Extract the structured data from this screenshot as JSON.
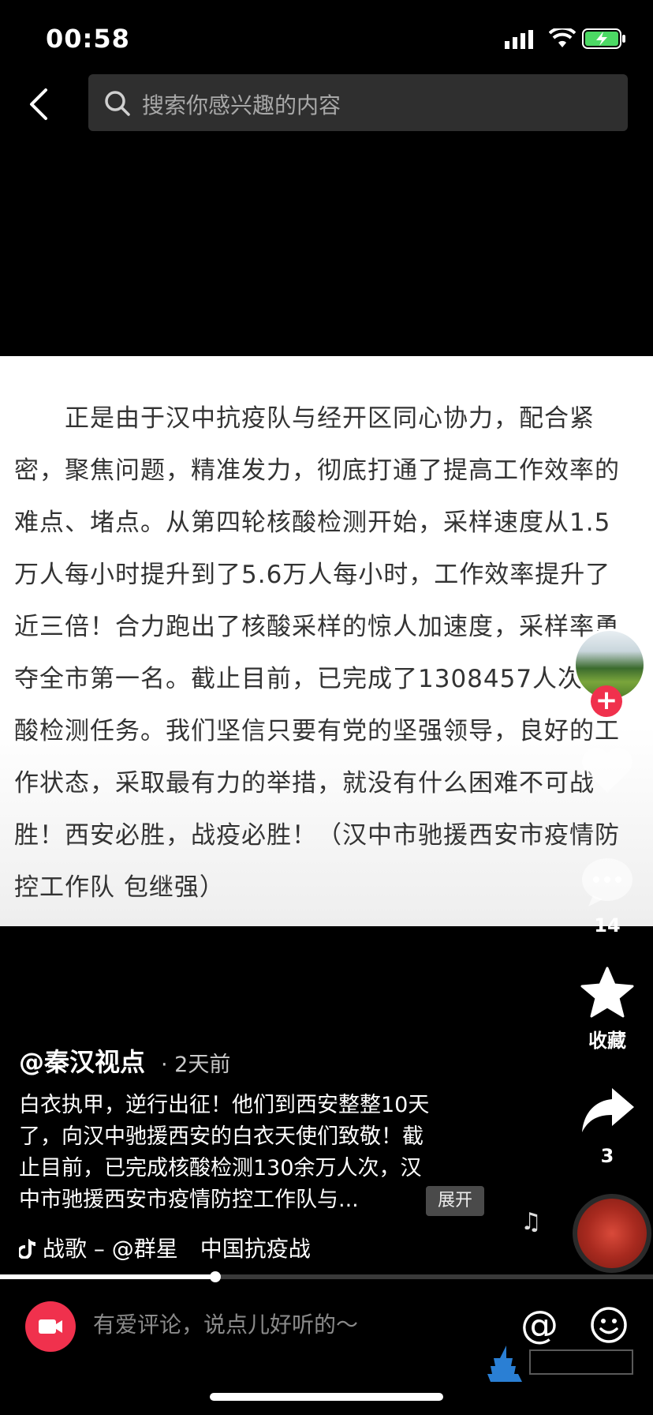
{
  "status": {
    "time": "00:58"
  },
  "search": {
    "placeholder": "搜索你感兴趣的内容"
  },
  "document_lines": [
    "　　正是由于汉中抗疫队与经开区同心协力，配合紧",
    "密，聚焦问题，精准发力，彻底打通了提高工作效率的",
    "难点、堵点。从第四轮核酸检测开始，采样速度从1.5",
    "万人每小时提升到了5.6万人每小时，工作效率提升了",
    "近三倍！合力跑出了核酸采样的惊人加速度，采样率勇",
    "夺全市第一名。截止目前，已完成了1308457人次",
    "酸检测任务。我们坚信只要有党的坚强领导，良好的工",
    "作状态，采取最有力的举措，就没有什么困难不可战",
    "胜！西安必胜，战疫必胜！（汉中市驰援西安市疫情防",
    "控工作队 包继强）"
  ],
  "actions": {
    "comment_count": "14",
    "favorite_label": "收藏",
    "share_count": "3"
  },
  "post": {
    "author": "@秦汉视点",
    "time_ago": "· 2天前",
    "description_lines": [
      "白衣执甲，逆行出征！他们到西安整整10天",
      "了，向汉中驰援西安的白衣天使们致敬！截",
      "止目前，已完成核酸检测130余万人次，汉",
      "中市驰援西安市疫情防控工作队与..."
    ],
    "expand_label": "展开",
    "music": "战歌 – @群星　中国抗疫战"
  },
  "progress": {
    "fraction": 0.33
  },
  "bottom": {
    "comment_placeholder": "有爱评论，说点儿好听的～",
    "at_symbol": "@"
  },
  "colors": {
    "accent": "#f0314d",
    "search_bg": "#2f2f2f"
  }
}
